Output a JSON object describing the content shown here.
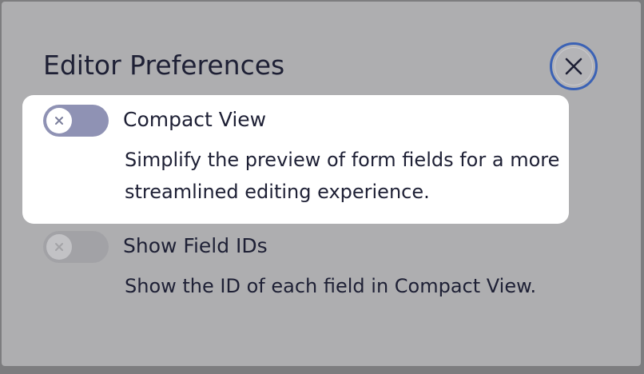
{
  "dialog": {
    "title": "Editor Preferences",
    "close_icon": "close-icon"
  },
  "options": [
    {
      "label": "Compact View",
      "description": "Simplify the preview of form fields for a more streamlined editing experience.",
      "enabled": false,
      "highlighted": true,
      "toggle_color": "#8f92b4"
    },
    {
      "label": "Show Field IDs",
      "description": "Show the ID of each field in Compact View.",
      "enabled": false,
      "highlighted": false,
      "toggle_color": "#a2a2a6"
    }
  ],
  "colors": {
    "overlay": "#aeaeb0",
    "highlight": "#ffffff",
    "text": "#1e2035",
    "focus_ring": "#3b62b5"
  }
}
